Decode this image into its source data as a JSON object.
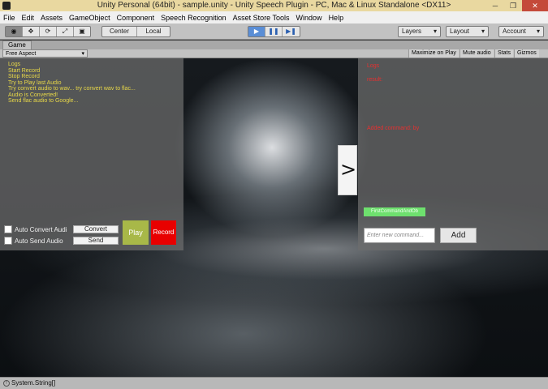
{
  "window": {
    "title": "Unity Personal (64bit) - sample.unity - Unity Speech Plugin - PC, Mac & Linux Standalone <DX11>",
    "minimize": "─",
    "restore": "❐",
    "close": "✕"
  },
  "menu": [
    "File",
    "Edit",
    "Assets",
    "GameObject",
    "Component",
    "Speech Recognition",
    "Asset Store Tools",
    "Window",
    "Help"
  ],
  "toolbar": {
    "tools": [
      "eye-icon",
      "move-icon",
      "rotate-icon",
      "scale-icon",
      "rect-icon"
    ],
    "tool_glyphs": [
      "◉",
      "✥",
      "⟳",
      "⤢",
      "▣"
    ],
    "pivot": "Center",
    "space": "Local",
    "play_glyph": "▶",
    "pause_glyph": "❚❚",
    "step_glyph": "▶❚",
    "layers": "Layers",
    "layout": "Layout",
    "account": "Account",
    "dropdown_arrow": "▾"
  },
  "game": {
    "tab": "Game",
    "aspect": "Free Aspect",
    "options": [
      "Maximize on Play",
      "Mute audio",
      "Stats",
      "Gizmos"
    ]
  },
  "left_panel": {
    "logs": [
      "Logs",
      "Start Record",
      "Stop Record",
      "Try to Play last Audio",
      "Try convert audio to wav... try convert wav to flac...",
      "Audio is Converted!",
      "Send flac audio to Google..."
    ],
    "auto_convert_label": "Auto Convert Audi",
    "auto_send_label": "Auto Send Audio",
    "convert_button": "Convert",
    "send_button": "Send",
    "play_button": "Play",
    "record_button": "Record"
  },
  "right_panel": {
    "logs_label": "Logs",
    "result_label": "result:",
    "added_label": "Added command: by",
    "command_tag": "FirstCommandAndOb",
    "input_placeholder": "Enter new command...",
    "add_button": "Add"
  },
  "toggle_arrow": ">",
  "status": {
    "icon": "!",
    "text": "System.String[]"
  }
}
